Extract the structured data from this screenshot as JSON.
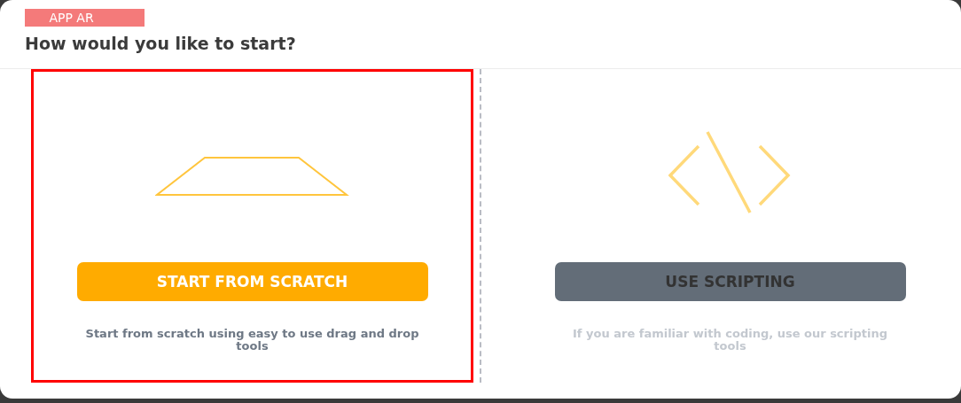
{
  "tag": "APP AR",
  "title": "How would you like to start?",
  "options": [
    {
      "kind": "scratch",
      "button": "START FROM SCRATCH",
      "description": "Start from scratch using easy to use drag and drop tools",
      "selected": true,
      "disabled": false
    },
    {
      "kind": "scripting",
      "button": "USE SCRIPTING",
      "description": "If you are familiar with coding, use our scripting tools",
      "selected": false,
      "disabled": true
    }
  ]
}
